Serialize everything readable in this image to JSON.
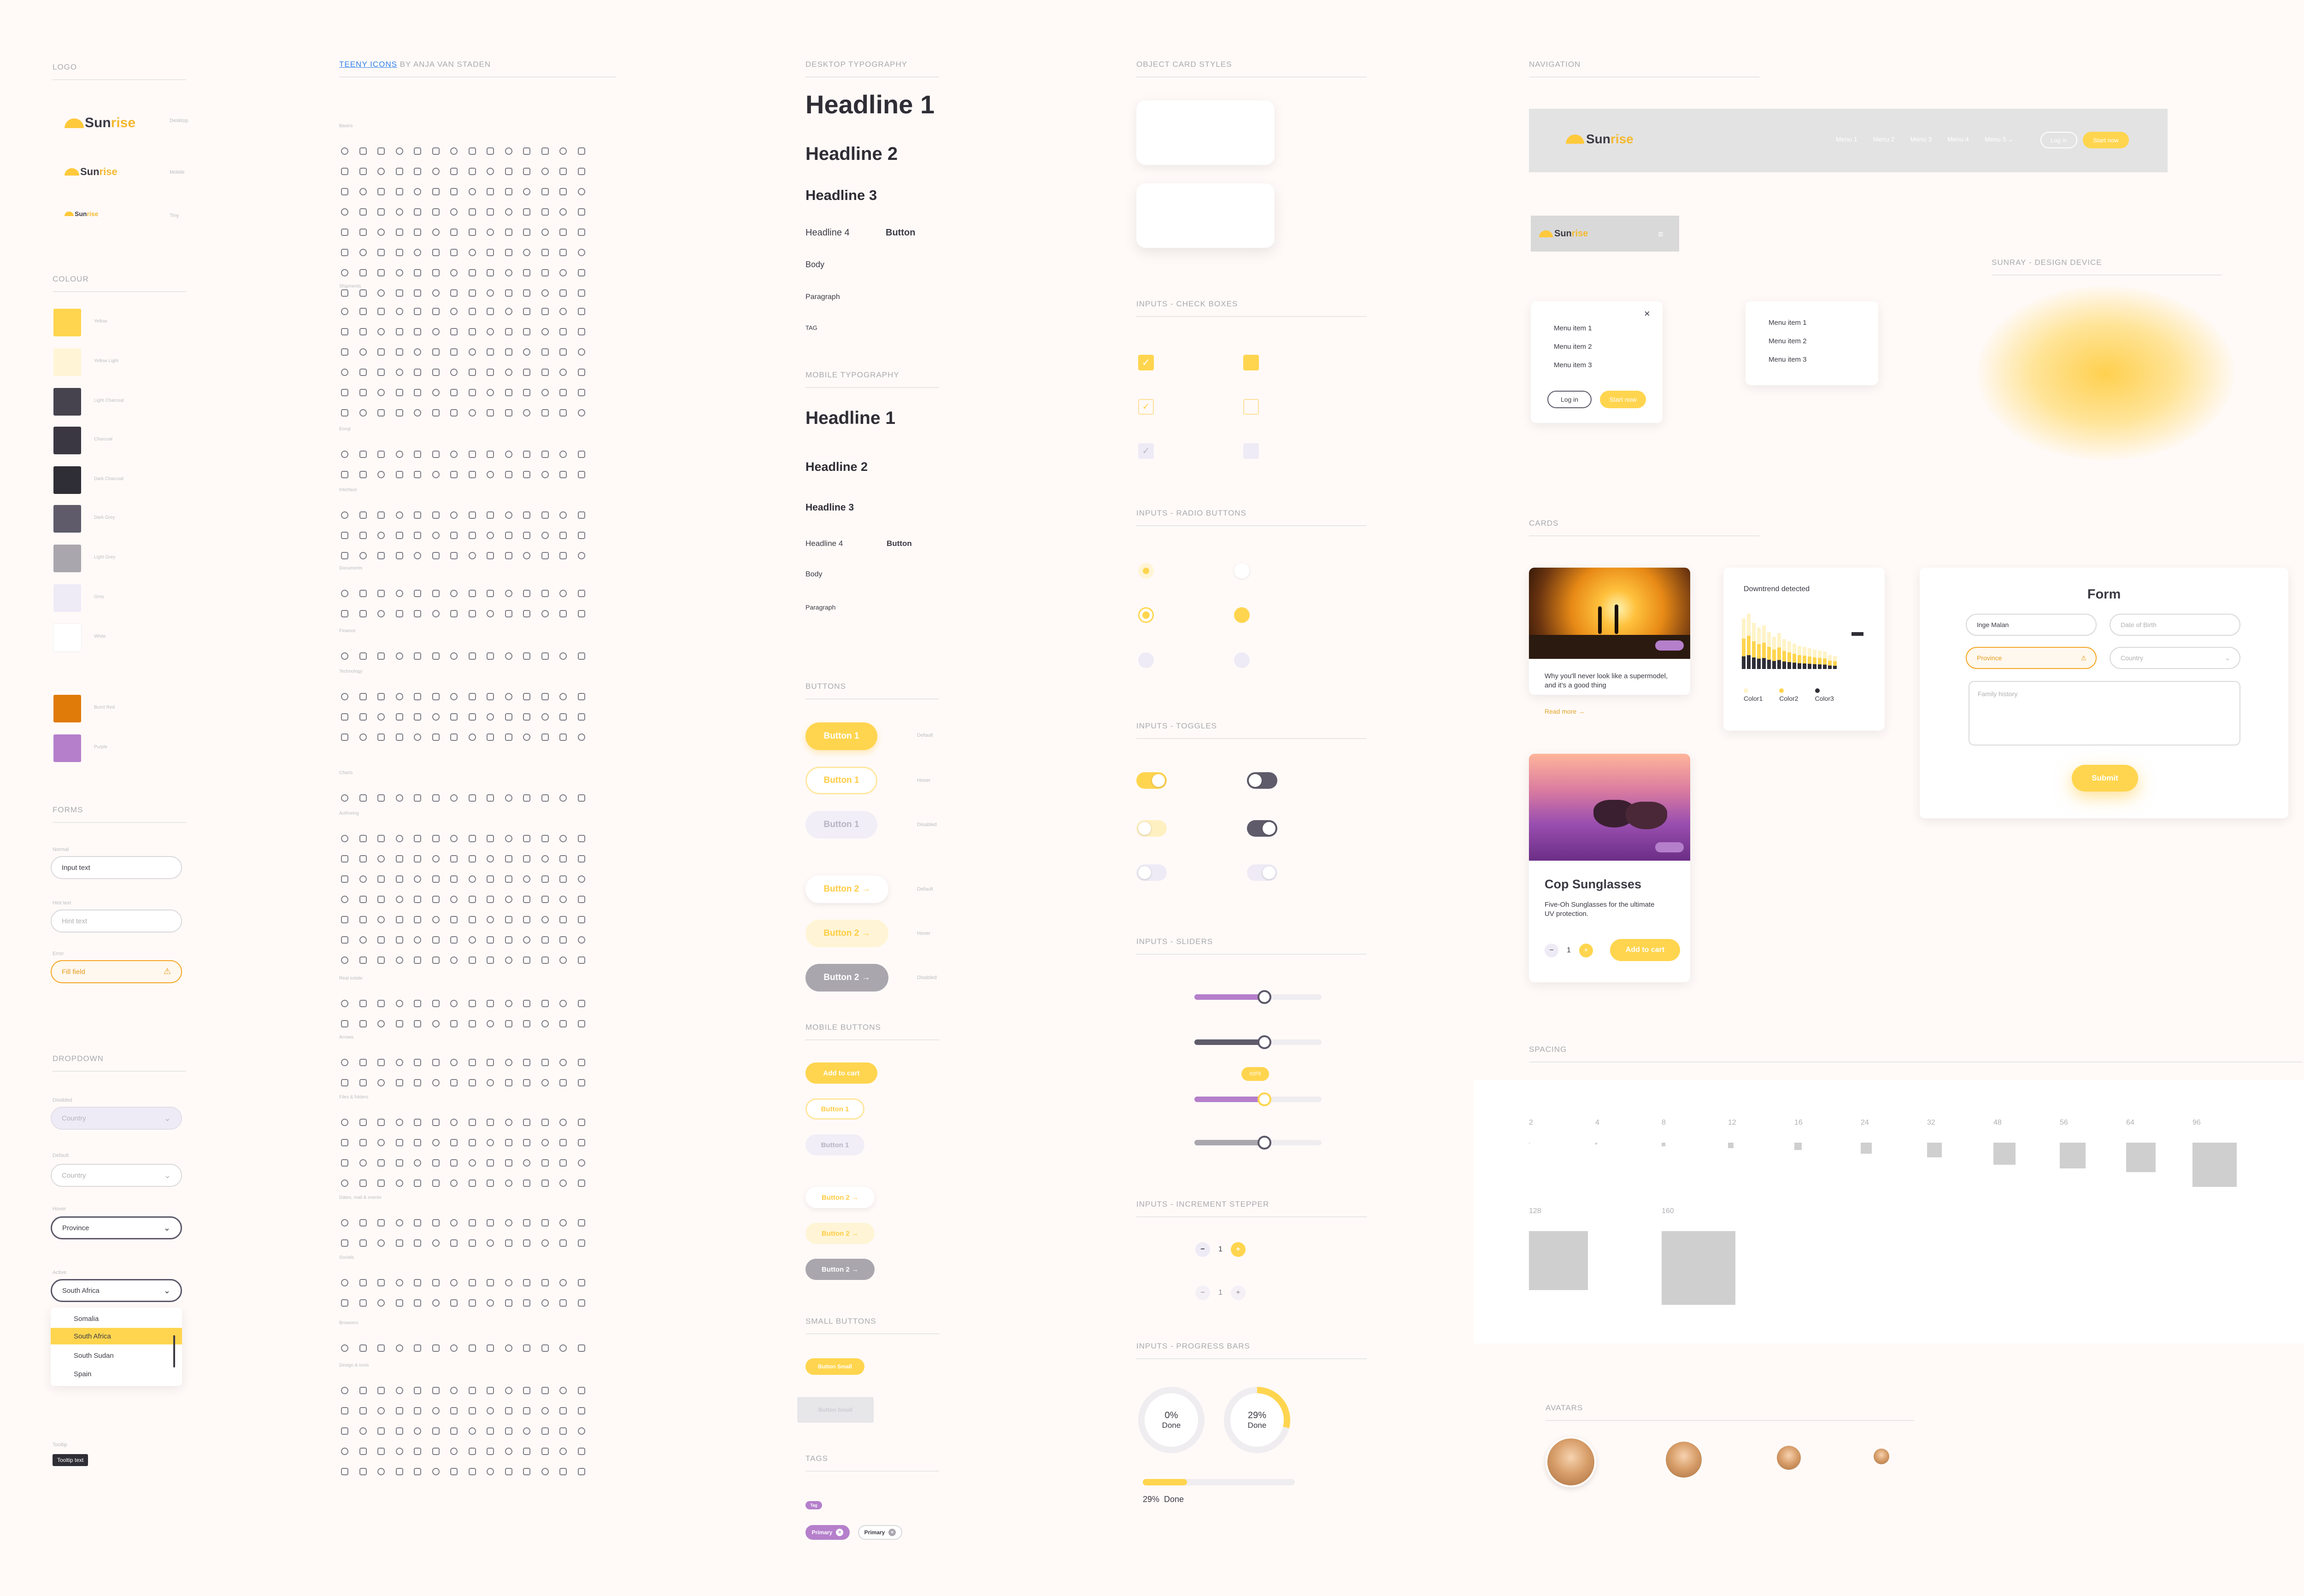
{
  "logo": {
    "section": "LOGO",
    "brand_a": "Sun",
    "brand_b": "rise",
    "sizes": [
      "Desktop",
      "Mobile",
      "Tiny"
    ]
  },
  "colour": {
    "section": "COLOUR",
    "swatches": [
      {
        "name": "Yellow",
        "hex": "#FFD54F"
      },
      {
        "name": "Yellow Light",
        "hex": "#FFF5D6"
      },
      {
        "name": "Light Charcoal",
        "hex": "#46434F"
      },
      {
        "name": "Charcoal",
        "hex": "#3A3742"
      },
      {
        "name": "Dark Charcoal",
        "hex": "#2F2D35"
      },
      {
        "name": "Dark Grey",
        "hex": "#5F5B6A"
      },
      {
        "name": "Light Grey",
        "hex": "#A9A6AE"
      },
      {
        "name": "Grey",
        "hex": "#EEEBF6"
      },
      {
        "name": "White",
        "hex": "#FFFFFF"
      },
      {
        "name": "Burnt Red",
        "hex": "#E07B0A"
      },
      {
        "name": "Purple",
        "hex": "#B57FCB"
      }
    ]
  },
  "forms": {
    "section": "FORMS",
    "normal_label": "Normal",
    "input_text": "Input text",
    "hint_label": "Hint text",
    "hint_text": "Hint text",
    "error_label": "Error",
    "fill_field": "Fill field"
  },
  "dropdown": {
    "section": "DROPDOWN",
    "disabled_label": "Disabled",
    "disabled": "Country",
    "default_label": "Default",
    "default": "Country",
    "hover_label": "Hover",
    "hover": "Province",
    "active_label": "Active",
    "active": "South Africa",
    "options": [
      "Somalia",
      "South Africa",
      "South Sudan",
      "Spain"
    ],
    "tooltip_label": "Tooltip",
    "tooltip": "Tooltip text"
  },
  "icons": {
    "section_link": "TEENY ICONS",
    "section_rest": " BY ANJA VAN STADEN",
    "groups": [
      "Basics",
      "Shipments",
      "Emoji",
      "Interface",
      "Documents",
      "Finance",
      "Technology",
      "Charts",
      "Authoring",
      "Real estate",
      "Arrows",
      "Files & folders",
      "Dates, mail & events",
      "Socials",
      "Browsers",
      "Design & tools"
    ]
  },
  "desktop_type": {
    "section": "DESKTOP TYPOGRAPHY",
    "h1": "Headline 1",
    "h2": "Headline 2",
    "h3": "Headline 3",
    "h4": "Headline 4",
    "button": "Button",
    "body": "Body",
    "paragraph": "Paragraph",
    "tag": "TAG"
  },
  "mobile_type": {
    "section": "MOBILE TYPOGRAPHY",
    "h1": "Headline 1",
    "h2": "Headline 2",
    "h3": "Headline 3",
    "h4": "Headline 4",
    "button": "Button",
    "body": "Body",
    "paragraph": "Paragraph"
  },
  "buttons": {
    "section": "BUTTONS",
    "b1": "Button 1",
    "b2": "Button 2 →",
    "default": "Default",
    "hover": "Hover",
    "disabled": "Disabled"
  },
  "mobile_buttons": {
    "section": "MOBILE BUTTONS",
    "add": "Add to cart",
    "b1": "Button 1",
    "b2": "Button 2 →"
  },
  "small_buttons": {
    "section": "SMALL BUTTONS",
    "label": "Button Small"
  },
  "tags": {
    "section": "TAGS",
    "tag": "Tag",
    "primary": "Primary"
  },
  "object_cards": {
    "section": "OBJECT CARD STYLES"
  },
  "checkboxes": {
    "section": "INPUTS - CHECK BOXES"
  },
  "radios": {
    "section": "INPUTS - RADIO BUTTONS"
  },
  "toggles": {
    "section": "INPUTS - TOGGLES"
  },
  "sliders": {
    "section": "INPUTS - SLIDERS",
    "bubble": "#2F5",
    "levels": [
      0.55,
      0.55,
      0.55,
      0.55
    ]
  },
  "stepper": {
    "section": "INPUTS - INCREMENT STEPPER",
    "value": "1"
  },
  "progress": {
    "section": "INPUTS - PROGRESS BARS",
    "c1_pct": "0%",
    "c1_done": "Done",
    "c2_pct": "29%",
    "c2_done": "Done",
    "bar_text": "29%  Done",
    "values": [
      0,
      0.29,
      0.29
    ]
  },
  "nav": {
    "section": "NAVIGATION",
    "menus": [
      "Menu 1",
      "Menu 2",
      "Menu 3",
      "Menu 4",
      "Menu 5 ⌄"
    ],
    "login": "Log in",
    "start": "Start now",
    "mobile_items": [
      "Menu item 1",
      "Menu item 2",
      "Menu item 3"
    ]
  },
  "device": {
    "section": "SUNRAY - DESIGN DEVICE"
  },
  "cards": {
    "section": "CARDS",
    "article_title": "Why you'll never look like a supermodel, and it's a good thing",
    "read_more": "Read more →",
    "chart_title": "Downtrend detected",
    "legend": [
      "Color1",
      "Color2",
      "Color3"
    ],
    "product_title": "Cop Sunglasses",
    "product_desc": "Five-Oh Sunglasses for the ultimate UV protection.",
    "qty": "1",
    "add": "Add to cart"
  },
  "form_card": {
    "title": "Form",
    "name": "Inge Malan",
    "dob": "Date of Birth",
    "province": "Province",
    "country": "Country",
    "history": "Family history",
    "submit": "Submit"
  },
  "spacing": {
    "section": "SPACING",
    "values": [
      "2",
      "4",
      "8",
      "12",
      "16",
      "24",
      "32",
      "48",
      "56",
      "64",
      "96",
      "128",
      "160"
    ]
  },
  "avatars": {
    "section": "AVATARS"
  }
}
